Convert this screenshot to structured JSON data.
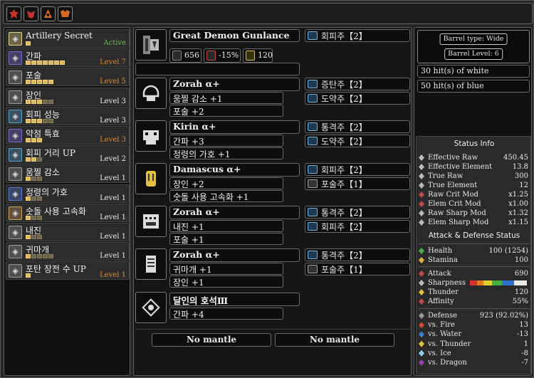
{
  "topbar": {
    "icons": [
      {
        "name": "red-monster-icon-1",
        "color": "#c8322a"
      },
      {
        "name": "red-monster-icon-2",
        "color": "#c8322a"
      },
      {
        "name": "orange-monster-icon",
        "color": "#d9691f"
      },
      {
        "name": "orange-monster-icon-2",
        "color": "#d9691f"
      }
    ]
  },
  "skills": [
    {
      "name": "Artillery Secret",
      "level": "Active",
      "pips": 1,
      "on": 1,
      "color": "#e8d48a",
      "status": "green"
    },
    {
      "name": "간파",
      "level": "Level 7",
      "pips": 7,
      "on": 7,
      "color": "#7a6ad0",
      "status": "orange"
    },
    {
      "name": "포술",
      "level": "Level 5",
      "pips": 5,
      "on": 5,
      "color": "#9a9a9a",
      "status": "orange"
    },
    {
      "name": "장인",
      "level": "Level 3",
      "pips": 5,
      "on": 3,
      "color": "#9a9a9a",
      "status": "white"
    },
    {
      "name": "회피 성능",
      "level": "Level 3",
      "pips": 5,
      "on": 3,
      "color": "#5aa0c8",
      "status": "white"
    },
    {
      "name": "약점 특효",
      "level": "Level 3",
      "pips": 3,
      "on": 3,
      "color": "#7a6ad0",
      "status": "orange"
    },
    {
      "name": "회피 거리 UP",
      "level": "Level 2",
      "pips": 3,
      "on": 2,
      "color": "#5aa0c8",
      "status": "white"
    },
    {
      "name": "움찔 감소",
      "level": "Level 1",
      "pips": 3,
      "on": 1,
      "color": "#9a9a9a",
      "status": "white"
    },
    {
      "name": "정령의 가호",
      "level": "Level 1",
      "pips": 3,
      "on": 1,
      "color": "#5a7ad0",
      "status": "white"
    },
    {
      "name": "숫돌 사용 고속화",
      "level": "Level 1",
      "pips": 3,
      "on": 1,
      "color": "#c8a060",
      "status": "white"
    },
    {
      "name": "내진",
      "level": "Level 1",
      "pips": 3,
      "on": 1,
      "color": "#9a9a9a",
      "status": "white"
    },
    {
      "name": "귀마개",
      "level": "Level 1",
      "pips": 5,
      "on": 1,
      "color": "#9a9a9a",
      "status": "white"
    },
    {
      "name": "포탄 장전 수 UP",
      "level": "Level 1",
      "pips": 1,
      "on": 1,
      "color": "#9a9a9a",
      "status": "orange"
    }
  ],
  "weapon": {
    "name": "Great Demon Gunlance",
    "attack": "656",
    "affinity": "-15%",
    "element": "120",
    "deco": "회피주【2】"
  },
  "armor": [
    {
      "name": "Zorah α+",
      "skills": [
        "움찔 감소 +1",
        "포술 +2"
      ],
      "decos": [
        "증탄주【2】",
        "도약주【2】"
      ]
    },
    {
      "name": "Kirin α+",
      "skills": [
        "간파 +3",
        "정령의 가호 +1"
      ],
      "decos": [
        "통격주【2】",
        "도약주【2】"
      ]
    },
    {
      "name": "Damascus α+",
      "skills": [
        "장인 +2",
        "숫돌 사용 고속화 +1"
      ],
      "decos": [
        "회피주【2】",
        "포술주【1】"
      ]
    },
    {
      "name": "Zorah α+",
      "skills": [
        "내진 +1",
        "포술 +1"
      ],
      "decos": [
        "통격주【2】",
        "회피주【2】"
      ]
    },
    {
      "name": "Zorah α+",
      "skills": [
        "귀마개 +1",
        "장인 +1"
      ],
      "decos": [
        "통격주【2】",
        "포술주【1】"
      ]
    }
  ],
  "charm": {
    "name": "달인의 호석Ⅲ",
    "skills": [
      "간파 +4"
    ]
  },
  "mantles": [
    "No mantle",
    "No mantle"
  ],
  "barrel": {
    "type": "Barrel type: Wide",
    "level": "Barrel Level: 6"
  },
  "hits": [
    "30 hit(s) of white",
    "50 hit(s) of blue"
  ],
  "status_info": {
    "header": "Status Info",
    "rows": [
      {
        "label": "Effective Raw",
        "value": "450.45",
        "icon": "#bbbbbb"
      },
      {
        "label": "Effective Element",
        "value": "13.8",
        "icon": "#bbbbbb"
      },
      {
        "label": "True Raw",
        "value": "300",
        "icon": "#bbbbbb"
      },
      {
        "label": "True Element",
        "value": "12",
        "icon": "#bbbbbb"
      },
      {
        "label": "Raw Crit Mod",
        "value": "x1.25",
        "icon": "#c04848"
      },
      {
        "label": "Elem Crit Mod",
        "value": "x1.00",
        "icon": "#c04848"
      },
      {
        "label": "Raw Sharp Mod",
        "value": "x1.32",
        "icon": "#bbbbbb"
      },
      {
        "label": "Elem Sharp Mod",
        "value": "x1.15",
        "icon": "#bbbbbb"
      }
    ]
  },
  "attack_defense": {
    "header": "Attack & Defense Status",
    "health": {
      "label": "Health",
      "value": "100 (1254)",
      "icon": "#4caf50"
    },
    "stamina": {
      "label": "Stamina",
      "value": "100",
      "icon": "#e0b040"
    },
    "attack_rows": [
      {
        "label": "Attack",
        "value": "690",
        "icon": "#c04848"
      },
      {
        "label": "Sharpness",
        "value": "",
        "icon": "#bbbbbb"
      },
      {
        "label": "Thunder",
        "value": "120",
        "icon": "#e0c040"
      },
      {
        "label": "Affinity",
        "value": "55%",
        "icon": "#c04848"
      }
    ],
    "sharpness_colors": [
      "#d83030",
      "#e07a20",
      "#e0d030",
      "#40b040",
      "#3070d0",
      "#e8e8e8"
    ],
    "sharpness_levels": [
      0.12,
      0.12,
      0.15,
      0.17,
      0.21,
      0.23
    ],
    "defense_rows": [
      {
        "label": "Defense",
        "value": "923 (92.02%)",
        "icon": "#9a9a9a"
      },
      {
        "label": "vs. Fire",
        "value": "13",
        "icon": "#d84830"
      },
      {
        "label": "vs. Water",
        "value": "-13",
        "icon": "#3a80d0"
      },
      {
        "label": "vs. Thunder",
        "value": "1",
        "icon": "#e0c040"
      },
      {
        "label": "vs. Ice",
        "value": "-8",
        "icon": "#90d0e8"
      },
      {
        "label": "vs. Dragon",
        "value": "-7",
        "icon": "#9a40b0"
      }
    ]
  }
}
